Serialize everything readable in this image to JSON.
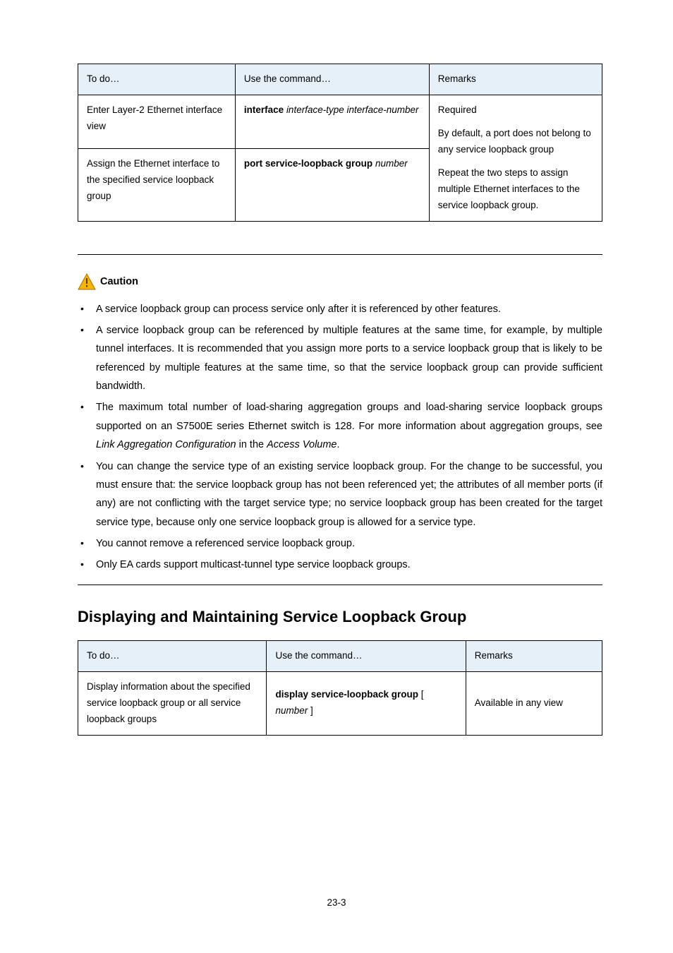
{
  "table1": {
    "headers": [
      "To do…",
      "Use the command…",
      "Remarks"
    ],
    "rows": [
      {
        "c1": "Enter Layer-2 Ethernet interface view",
        "c2_bold": "interface",
        "c2_ital": "interface-type interface-number",
        "c3_top": "Required",
        "c3_rest": "By default, a port does not belong to any service loopback group"
      },
      {
        "c1": "Assign the Ethernet interface to the specified service loopback group",
        "c2_bold": "port service-loopback group",
        "c2_ital": "number",
        "c3": "Repeat the two steps to assign multiple Ethernet interfaces to the service loopback group."
      }
    ]
  },
  "caution": {
    "label": "Caution",
    "items": [
      {
        "text": "A service loopback group can process service only after it is referenced by other features."
      },
      {
        "text": "A service loopback group can be referenced by multiple features at the same time, for example, by multiple tunnel interfaces. It is recommended that you assign more ports to a service loopback group that is likely to be referenced by multiple features at the same time, so that the service loopback group can provide sufficient bandwidth."
      },
      {
        "pre": "The maximum total number of load-sharing aggregation groups and load-sharing service loopback groups supported on an S7500E series Ethernet switch is 128. For more information about aggregation groups, see ",
        "ital1": "Link Aggregation Configuration",
        "mid": " in the ",
        "ital2": "Access Volume",
        "post": "."
      },
      {
        "text": "You can change the service type of an existing service loopback group. For the change to be successful, you must ensure that: the service loopback group has not been referenced yet; the attributes of all member ports (if any) are not conflicting with the target service type; no service loopback group has been created for the target service type, because only one service loopback group is allowed for a service type."
      },
      {
        "text": "You cannot remove a referenced service loopback group."
      },
      {
        "text": "Only EA cards support multicast-tunnel type service loopback groups."
      }
    ]
  },
  "section_title": "Displaying and Maintaining Service Loopback Group",
  "table2": {
    "headers": [
      "To do…",
      "Use the command…",
      "Remarks"
    ],
    "row": {
      "c1": "Display information about the specified service loopback group or all service loopback groups",
      "c2_bold1": "display service-loopback group",
      "c2_br1": "[ ",
      "c2_ital": "number",
      "c2_br2": " ]",
      "c3": "Available in any view"
    }
  },
  "pagenum": "23-3"
}
